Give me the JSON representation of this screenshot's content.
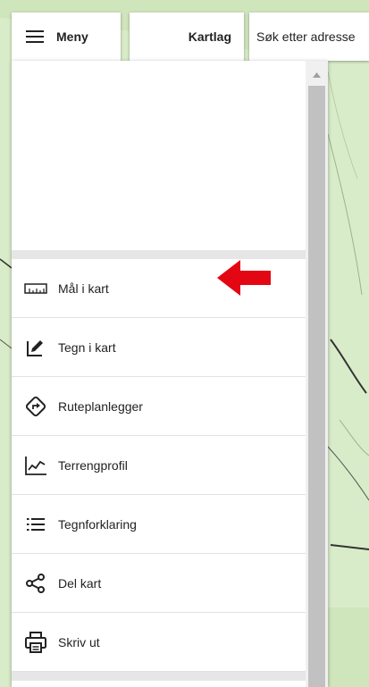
{
  "topbar": {
    "menu_label": "Meny",
    "layers_label": "Kartlag",
    "search_placeholder": "Søk etter adresse"
  },
  "menu": {
    "items": [
      {
        "label": "Mål i kart",
        "icon": "ruler-icon"
      },
      {
        "label": "Tegn i kart",
        "icon": "draw-icon"
      },
      {
        "label": "Ruteplanlegger",
        "icon": "route-icon"
      },
      {
        "label": "Terrengprofil",
        "icon": "elevation-profile-icon"
      },
      {
        "label": "Tegnforklaring",
        "icon": "legend-list-icon"
      },
      {
        "label": "Del kart",
        "icon": "share-icon"
      },
      {
        "label": "Skriv ut",
        "icon": "print-icon"
      }
    ]
  },
  "colors": {
    "highlight_arrow": "#e30613",
    "map_background": "#d9ecc9"
  }
}
